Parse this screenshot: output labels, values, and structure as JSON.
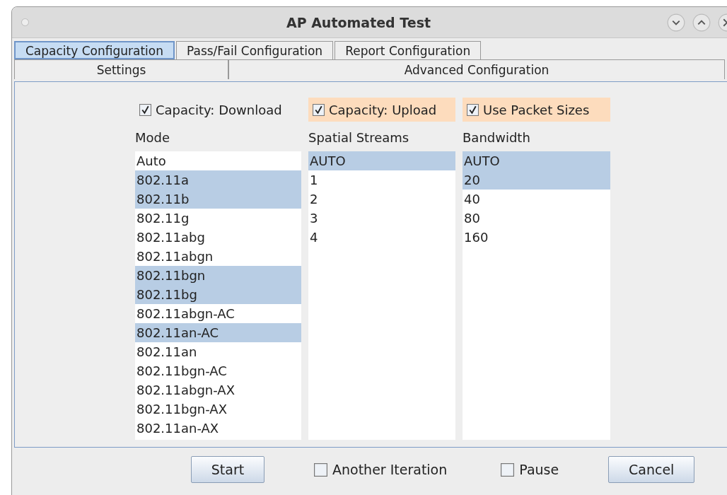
{
  "window": {
    "title": "AP Automated Test"
  },
  "tabs": [
    {
      "label": "Capacity Configuration",
      "selected": true
    },
    {
      "label": "Pass/Fail Configuration",
      "selected": false
    },
    {
      "label": "Report Configuration",
      "selected": false
    }
  ],
  "subtabs": [
    {
      "label": "Settings",
      "selected": false
    },
    {
      "label": "Advanced Configuration",
      "selected": false
    }
  ],
  "options": [
    {
      "label": "Capacity: Download",
      "checked": true,
      "highlighted": false
    },
    {
      "label": "Capacity: Upload",
      "checked": true,
      "highlighted": true
    },
    {
      "label": "Use Packet Sizes",
      "checked": true,
      "highlighted": true
    }
  ],
  "lists": [
    {
      "heading": "Mode",
      "items": [
        {
          "label": "Auto",
          "selected": false
        },
        {
          "label": "802.11a",
          "selected": true
        },
        {
          "label": "802.11b",
          "selected": true
        },
        {
          "label": "802.11g",
          "selected": false
        },
        {
          "label": "802.11abg",
          "selected": false
        },
        {
          "label": "802.11abgn",
          "selected": false
        },
        {
          "label": "802.11bgn",
          "selected": true
        },
        {
          "label": "802.11bg",
          "selected": true
        },
        {
          "label": "802.11abgn-AC",
          "selected": false
        },
        {
          "label": "802.11an-AC",
          "selected": true
        },
        {
          "label": "802.11an",
          "selected": false
        },
        {
          "label": "802.11bgn-AC",
          "selected": false
        },
        {
          "label": "802.11abgn-AX",
          "selected": false
        },
        {
          "label": "802.11bgn-AX",
          "selected": false
        },
        {
          "label": "802.11an-AX",
          "selected": false
        }
      ]
    },
    {
      "heading": "Spatial Streams",
      "items": [
        {
          "label": "AUTO",
          "selected": true
        },
        {
          "label": "1",
          "selected": false
        },
        {
          "label": "2",
          "selected": false
        },
        {
          "label": "3",
          "selected": false
        },
        {
          "label": "4",
          "selected": false
        }
      ]
    },
    {
      "heading": "Bandwidth",
      "items": [
        {
          "label": "AUTO",
          "selected": true
        },
        {
          "label": "20",
          "selected": true
        },
        {
          "label": "40",
          "selected": false
        },
        {
          "label": "80",
          "selected": false
        },
        {
          "label": "160",
          "selected": false
        }
      ]
    }
  ],
  "footer": {
    "start_button": "Start",
    "another_iteration": {
      "label": "Another Iteration",
      "checked": false
    },
    "pause": {
      "label": "Pause",
      "checked": false
    },
    "cancel_button": "Cancel"
  }
}
